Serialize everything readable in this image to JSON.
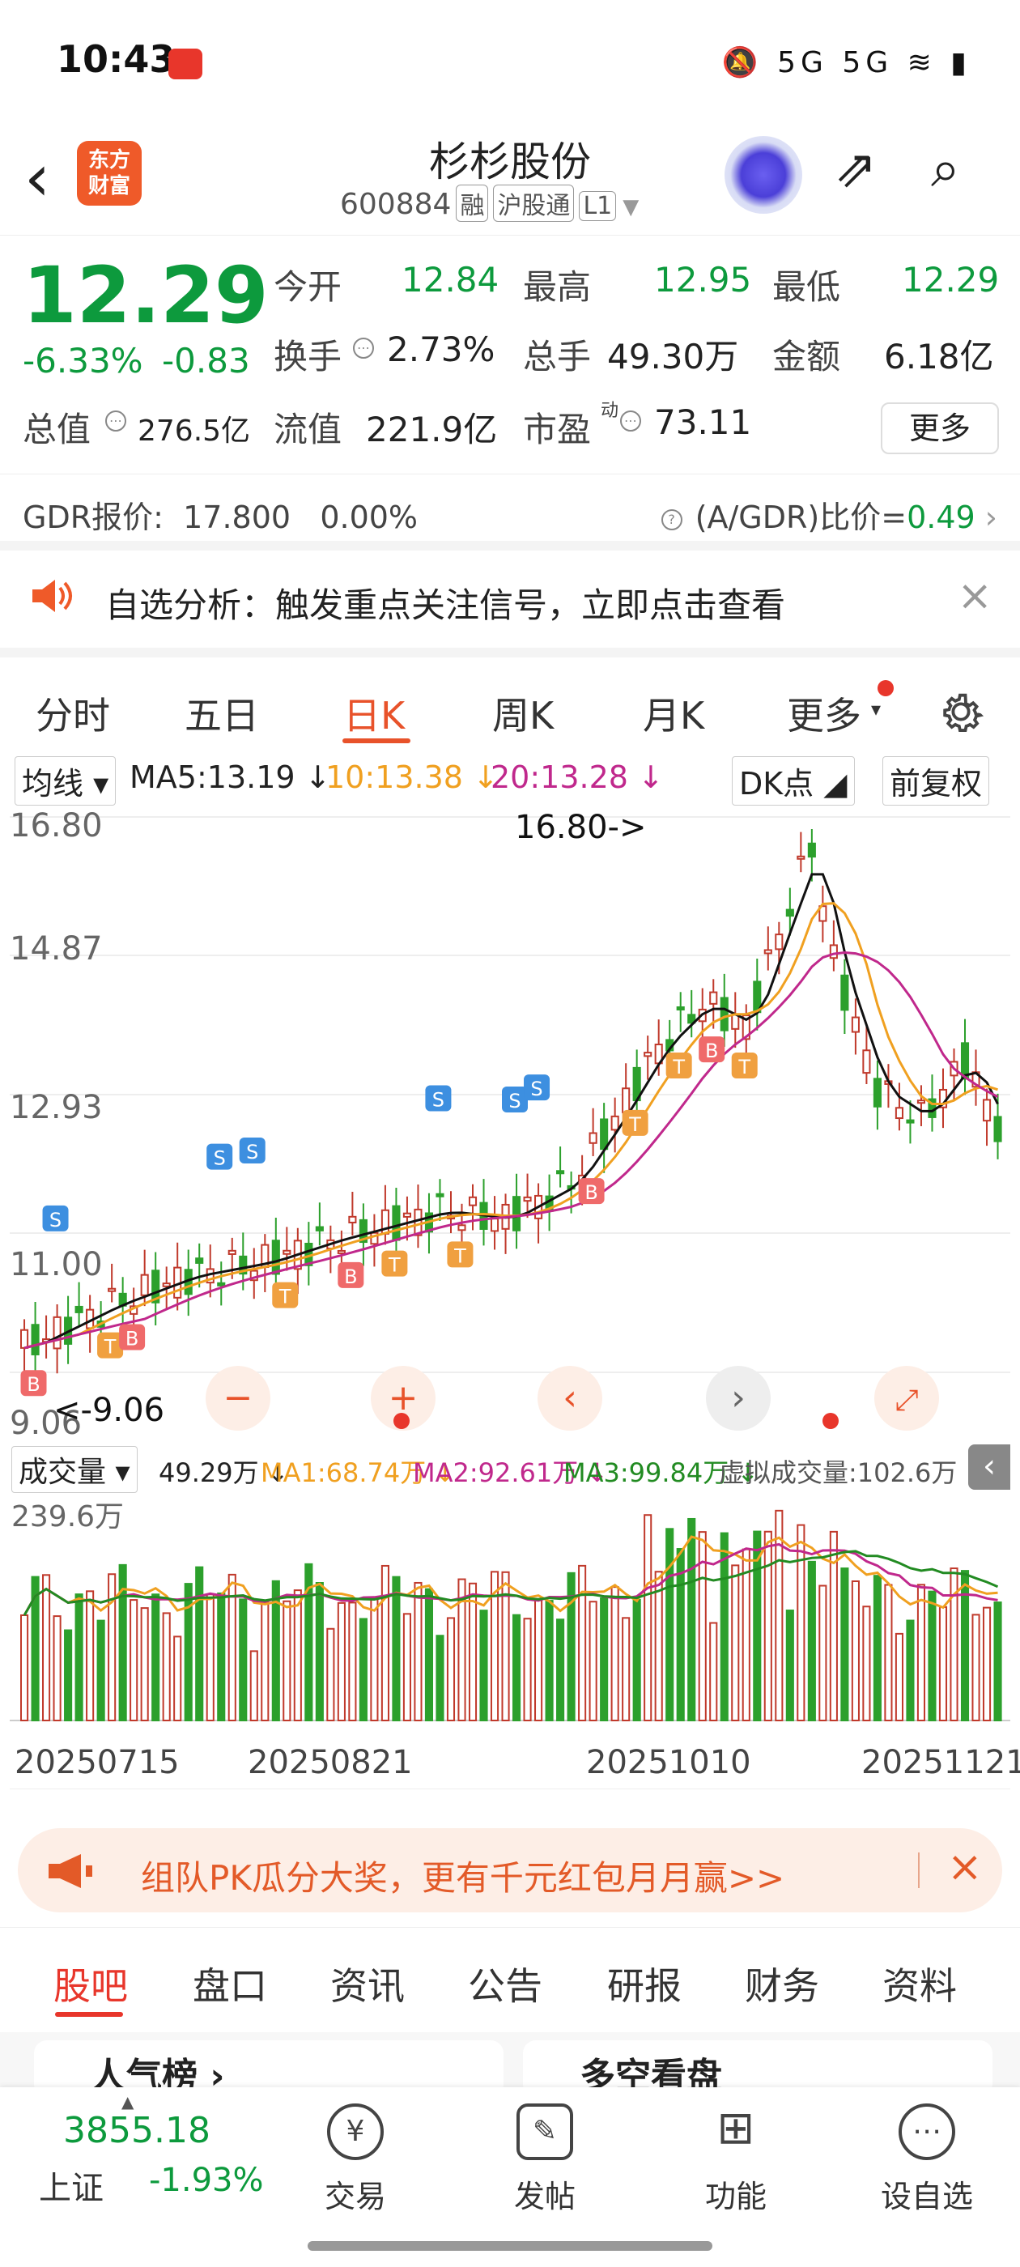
{
  "status_bar": {
    "time": "10:43",
    "icons": "🔕 5G 5G ≋ ▮"
  },
  "header": {
    "back_icon": "chevron-left-icon",
    "logo_text_1": "东方",
    "logo_text_2": "财富",
    "stock_name": "杉杉股份",
    "stock_code": "600884",
    "tags": [
      "融",
      "沪股通",
      "L1"
    ]
  },
  "quote": {
    "price": "12.29",
    "change_pct": "-6.33%",
    "change_abs": "-0.83",
    "open_label": "今开",
    "open": "12.84",
    "high_label": "最高",
    "high": "12.95",
    "low_label": "最低",
    "low": "12.29",
    "turnover_label": "换手",
    "turnover": "2.73%",
    "volume_label": "总手",
    "volume": "49.30万",
    "amount_label": "金额",
    "amount": "6.18亿",
    "total_mv_label": "总值",
    "total_mv": "276.5亿",
    "float_mv_label": "流值",
    "float_mv": "221.9亿",
    "pe_label": "市盈",
    "pe_sup": "动",
    "pe": "73.11",
    "more_button": "更多"
  },
  "gdr": {
    "label": "GDR报价:",
    "price": "17.800",
    "pct": "0.00%",
    "ratio_label": "(A/GDR)比价=",
    "ratio": "0.49"
  },
  "notice": {
    "text": "自选分析：触发重点关注信号，立即点击查看"
  },
  "chart_tabs": [
    "分时",
    "五日",
    "日K",
    "周K",
    "月K",
    "更多"
  ],
  "chart_tabs_active": "日K",
  "ma_bar": {
    "selector": "均线",
    "ma5": "MA5:13.19 ↓",
    "ma10": "10:13.38 ↓",
    "ma20": "20:13.28 ↓",
    "dk_button": "DK点",
    "adjust_button": "前复权"
  },
  "kline": {
    "y_labels": [
      "16.80",
      "14.87",
      "12.93",
      "11.00",
      "9.06"
    ],
    "max_marker": "16.80->",
    "min_marker": "<-9.06"
  },
  "volume_bar": {
    "selector": "成交量",
    "vol": "49.29万 ↓",
    "ma1": "MA1:68.74万 ↓",
    "ma2": "MA2:92.61万 ↓",
    "ma3": "MA3:99.84万 ↓",
    "virtual": "虚拟成交量:102.6万",
    "max_label": "239.6万"
  },
  "dates": [
    "20250715",
    "20250821",
    "20251010",
    "20251121"
  ],
  "pk_banner": {
    "text": "组队PK瓜分大奖，更有千元红包月月赢>>"
  },
  "bottom_tabs": [
    "股吧",
    "盘口",
    "资讯",
    "公告",
    "研报",
    "财务",
    "资料"
  ],
  "bottom_tabs_active": "股吧",
  "peek": {
    "card1": "人气榜 ›",
    "card2": "多空看盘"
  },
  "index": {
    "value": "3855.18",
    "name": "上证",
    "pct": "-1.93%"
  },
  "nav": [
    {
      "label": "交易",
      "icon": "yen-icon"
    },
    {
      "label": "发帖",
      "icon": "edit-icon"
    },
    {
      "label": "功能",
      "icon": "grid-icon"
    },
    {
      "label": "设自选",
      "icon": "more-icon"
    }
  ],
  "colors": {
    "up": "#e8362b",
    "down": "#0d9a3d",
    "accent": "#e8522a"
  }
}
